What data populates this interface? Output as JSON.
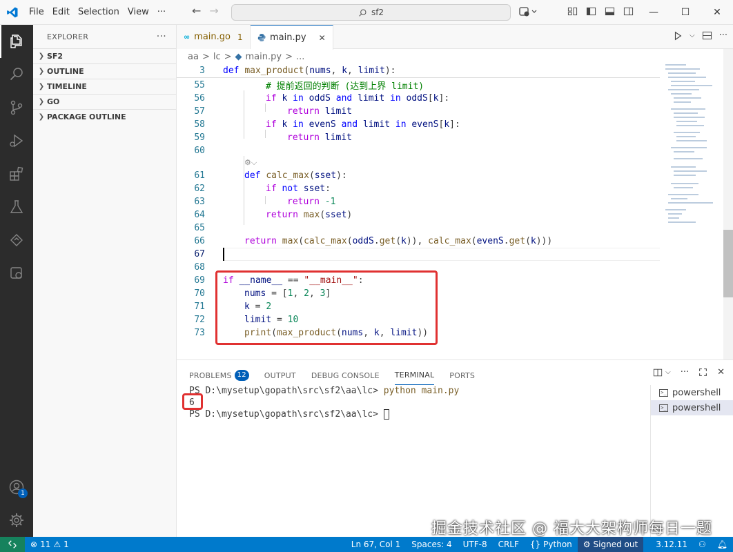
{
  "colors": {
    "accent": "#005fb8",
    "statusbar": "#007acc",
    "highlight_box": "#e03131",
    "activity_bg": "#2c2c2c"
  },
  "menu": [
    "File",
    "Edit",
    "Selection",
    "View",
    "···"
  ],
  "search": {
    "text": "sf2"
  },
  "sidebar": {
    "title": "EXPLORER",
    "more": "···",
    "sections": [
      {
        "label": "SF2"
      },
      {
        "label": "OUTLINE"
      },
      {
        "label": "TIMELINE"
      },
      {
        "label": "GO"
      },
      {
        "label": "PACKAGE OUTLINE"
      }
    ]
  },
  "activity": {
    "account_badge": "1"
  },
  "tabs": [
    {
      "label": "main.go",
      "problems": "1",
      "icon": "go-file-icon"
    },
    {
      "label": "main.py",
      "close": "✕",
      "icon": "python-file-icon"
    }
  ],
  "breadcrumb": [
    "aa",
    ">",
    "lc",
    ">",
    "main.py",
    ">",
    "..."
  ],
  "editor": {
    "lines": [
      {
        "n": "3"
      },
      {
        "n": "55"
      },
      {
        "n": "56"
      },
      {
        "n": "57"
      },
      {
        "n": "58"
      },
      {
        "n": "59"
      },
      {
        "n": "60"
      },
      {
        "n": "61"
      },
      {
        "n": "62"
      },
      {
        "n": "63"
      },
      {
        "n": "64"
      },
      {
        "n": "65"
      },
      {
        "n": "66"
      },
      {
        "n": "67"
      },
      {
        "n": "68"
      },
      {
        "n": "69"
      },
      {
        "n": "70"
      },
      {
        "n": "71"
      },
      {
        "n": "72"
      },
      {
        "n": "73"
      }
    ],
    "tokens": {
      "l3": [
        "def",
        " ",
        "max_product",
        "(",
        "nums",
        ", ",
        "k",
        ", ",
        "limit",
        "):"
      ],
      "l55": "# 提前返回的判断 (达到上界 limit)",
      "l56": [
        "if",
        " ",
        "k",
        " ",
        "in",
        " ",
        "oddS",
        "[",
        "k",
        "]:"
      ],
      "l56_and": "and",
      "l56_limit": "limit",
      "l57": [
        "return",
        " ",
        "limit"
      ],
      "l58": [
        "if",
        " ",
        "k",
        " ",
        "in",
        " ",
        "evenS",
        "[",
        "k",
        "]:"
      ],
      "l58_and": "and",
      "l58_limit": "limit",
      "l59": [
        "return",
        " ",
        "limit"
      ],
      "l61": [
        "def",
        " ",
        "calc_max",
        "(",
        "sset",
        "):"
      ],
      "l62": [
        "if",
        " ",
        "not",
        " ",
        "sset",
        ":"
      ],
      "l63": [
        "return",
        " ",
        "-1"
      ],
      "l64": [
        "return",
        " ",
        "max",
        "(",
        "sset",
        ")"
      ],
      "l66": [
        "return",
        " ",
        "max",
        "(",
        "calc_max",
        "(",
        "oddS",
        ".",
        "get",
        "(",
        "k",
        ")), ",
        "calc_max",
        "(",
        "evenS",
        ".",
        "get",
        "(",
        "k",
        ")))"
      ],
      "l69": [
        "if",
        " ",
        "__name__",
        " == ",
        "\"__main__\"",
        ":"
      ],
      "l70": [
        "nums",
        " = [",
        "1",
        ", ",
        "2",
        ", ",
        "3",
        "]"
      ],
      "l71": [
        "k",
        " = ",
        "2"
      ],
      "l72": [
        "limit",
        " = ",
        "10"
      ],
      "l73": [
        "print",
        "(",
        "max_product",
        "(",
        "nums",
        ", ",
        "k",
        ", ",
        "limit",
        "))"
      ]
    }
  },
  "panel": {
    "tabs": [
      {
        "label": "PROBLEMS",
        "badge": "12"
      },
      {
        "label": "OUTPUT"
      },
      {
        "label": "DEBUG CONSOLE"
      },
      {
        "label": "TERMINAL"
      },
      {
        "label": "PORTS"
      }
    ],
    "terminal": {
      "prompt1": "PS D:\\mysetup\\gopath\\src\\sf2\\aa\\lc> ",
      "cmd1": "python main.py",
      "output": "6",
      "prompt2": "PS D:\\mysetup\\gopath\\src\\sf2\\aa\\lc> "
    },
    "terminals": [
      "powershell",
      "powershell"
    ]
  },
  "statusbar": {
    "errors": "11",
    "warnings": "1",
    "position": "Ln 67, Col 1",
    "spaces": "Spaces: 4",
    "encoding": "UTF-8",
    "eol": "CRLF",
    "language": "Python",
    "account": "Signed out",
    "python_version": "3.12.11"
  },
  "watermark": "掘金技术社区 @ 福大大架构师每日一题"
}
